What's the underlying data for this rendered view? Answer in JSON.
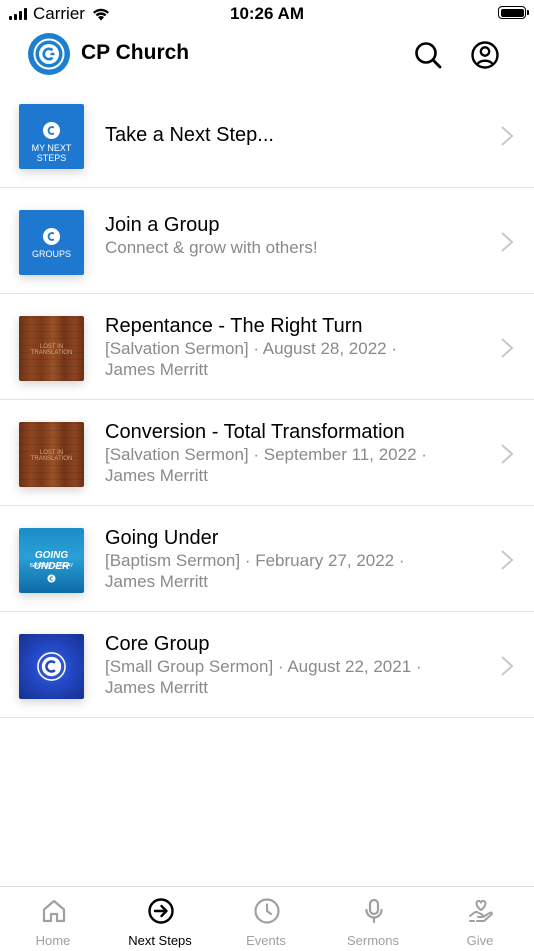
{
  "status_bar": {
    "carrier": "Carrier",
    "time": "10:26 AM"
  },
  "header": {
    "title": "CP Church",
    "logo_icon": "church-logo-icon",
    "search_icon": "search-icon",
    "profile_icon": "profile-icon"
  },
  "colors": {
    "brand_blue": "#1d7fd0",
    "subtitle_gray": "#8a8a8a",
    "divider": "#e2e2e2",
    "inactive_tab": "#a0a0a0"
  },
  "items": [
    {
      "title": "Take a Next Step...",
      "subtitle": "",
      "author": "",
      "thumb_label": "MY NEXT STEPS"
    },
    {
      "title": "Join a Group",
      "subtitle": "Connect & grow with others!",
      "author": "",
      "thumb_label": "GROUPS"
    },
    {
      "title": "Repentance - The Right Turn",
      "subtitle": "[Salvation Sermon] · August 28, 2022 ·",
      "author": "James Merritt",
      "thumb_label": "LOST IN TRANSLATION"
    },
    {
      "title": "Conversion - Total Transformation",
      "subtitle": "[Salvation Sermon] · September 11, 2022 ·",
      "author": "James Merritt",
      "thumb_label": "LOST IN TRANSLATION"
    },
    {
      "title": "Going Under",
      "subtitle": "[Baptism Sermon] · February 27, 2022 ·",
      "author": "James Merritt",
      "thumb_label": "GOING UNDER",
      "thumb_sublabel": "BAPTISM SUNDAY"
    },
    {
      "title": "Core Group",
      "subtitle": "[Small Group Sermon] · August 22, 2021 ·",
      "author": "James Merritt",
      "thumb_label": ""
    }
  ],
  "tabs": [
    {
      "label": "Home",
      "icon": "home-icon"
    },
    {
      "label": "Next Steps",
      "icon": "arrow-circle-icon"
    },
    {
      "label": "Events",
      "icon": "clock-icon"
    },
    {
      "label": "Sermons",
      "icon": "microphone-icon"
    },
    {
      "label": "Give",
      "icon": "give-hand-heart-icon"
    }
  ],
  "active_tab": "Next Steps"
}
